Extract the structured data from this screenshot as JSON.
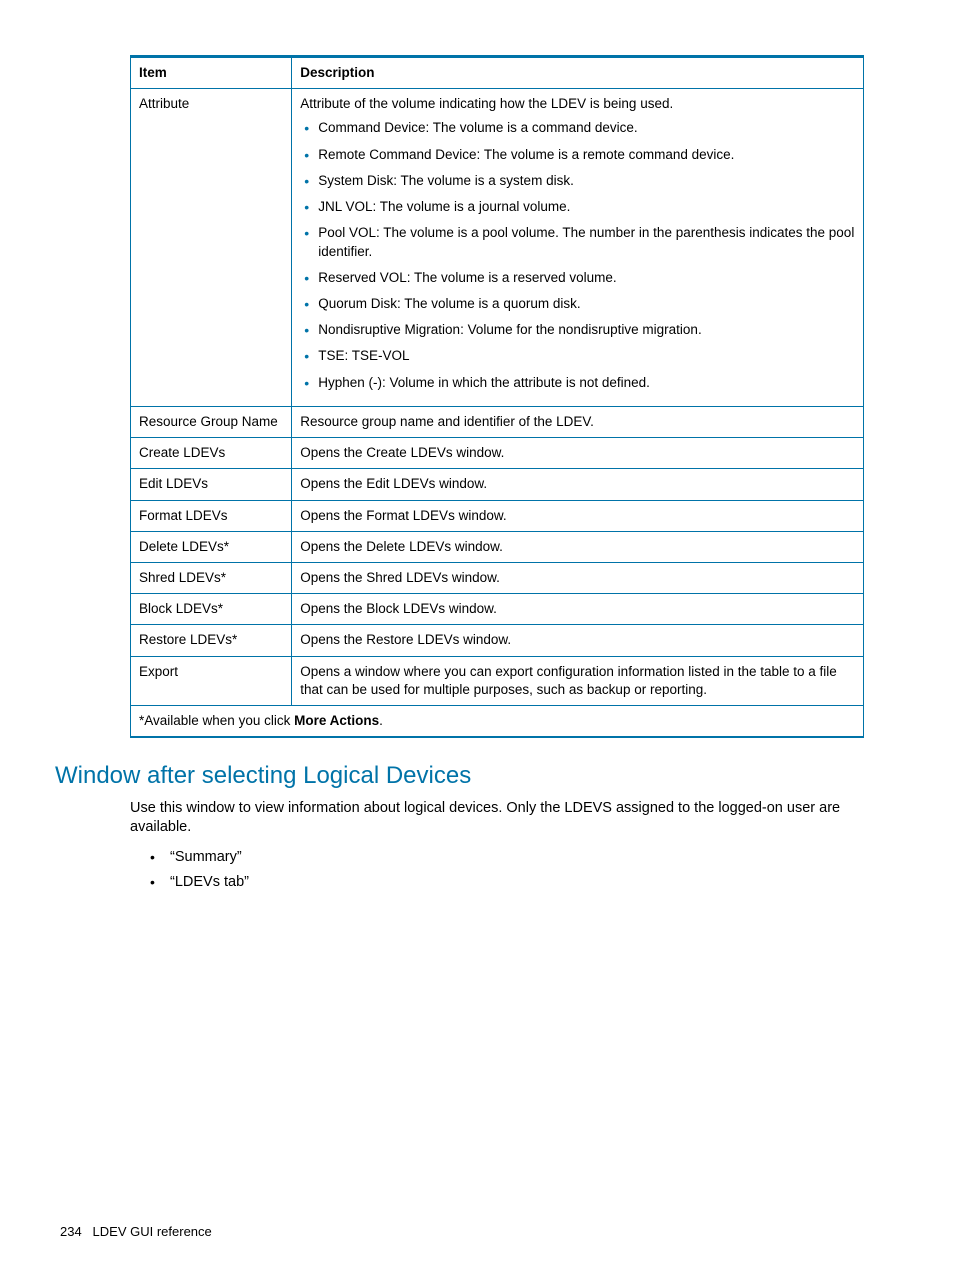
{
  "table": {
    "headers": {
      "item": "Item",
      "description": "Description"
    },
    "rows": [
      {
        "item": "Attribute",
        "intro": "Attribute of the volume indicating how the LDEV is being used.",
        "bullets": [
          "Command Device: The volume is a command device.",
          "Remote Command Device: The volume is a remote command device.",
          "System Disk: The volume is a system disk.",
          "JNL VOL: The volume is a journal volume.",
          "Pool VOL: The volume is a pool volume. The number in the parenthesis indicates the pool identifier.",
          "Reserved VOL: The volume is a reserved volume.",
          "Quorum Disk: The volume is a quorum disk.",
          "Nondisruptive Migration: Volume for the nondisruptive migration.",
          "TSE: TSE-VOL",
          "Hyphen (-): Volume in which the attribute is not defined."
        ]
      },
      {
        "item": "Resource Group Name",
        "description": "Resource group name and identifier of the LDEV."
      },
      {
        "item": "Create LDEVs",
        "description": "Opens the Create LDEVs window."
      },
      {
        "item": "Edit LDEVs",
        "description": "Opens the Edit LDEVs window."
      },
      {
        "item": "Format LDEVs",
        "description": "Opens the Format LDEVs window."
      },
      {
        "item": "Delete LDEVs*",
        "description": "Opens the Delete LDEVs window."
      },
      {
        "item": "Shred LDEVs*",
        "description": "Opens the Shred LDEVs window."
      },
      {
        "item": "Block LDEVs*",
        "description": "Opens the Block LDEVs window."
      },
      {
        "item": "Restore LDEVs*",
        "description": "Opens the Restore LDEVs window."
      },
      {
        "item": "Export",
        "description": "Opens a window where you can export configuration information listed in the table to a file that can be used for multiple purposes, such as backup or reporting."
      }
    ],
    "footnote_prefix": "*Available when you click ",
    "footnote_bold": "More Actions",
    "footnote_suffix": "."
  },
  "section": {
    "heading": "Window after selecting Logical Devices",
    "intro": "Use this window to view information about logical devices. Only the LDEVS assigned to the logged-on user are available.",
    "links": [
      "“Summary”",
      "“LDEVs tab”"
    ]
  },
  "footer": {
    "page": "234",
    "title": "LDEV GUI reference"
  }
}
